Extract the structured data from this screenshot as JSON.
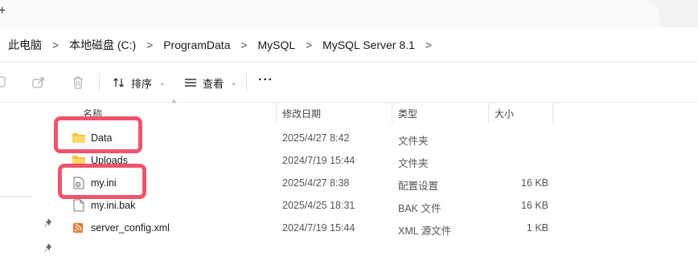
{
  "titlebar": {
    "new_tab_glyph": "+"
  },
  "breadcrumb": [
    {
      "label": "此电脑"
    },
    {
      "label": "本地磁盘 (C:)"
    },
    {
      "label": "ProgramData"
    },
    {
      "label": "MySQL"
    },
    {
      "label": "MySQL Server 8.1"
    }
  ],
  "breadcrumb_separator": ">",
  "toolbar": {
    "sort_label": "排序",
    "view_label": "查看",
    "more_label": "···",
    "dropdown_glyph": "⌄"
  },
  "columns": {
    "name": "名称",
    "date": "修改日期",
    "type": "类型",
    "size": "大小"
  },
  "files": [
    {
      "name": "Data",
      "date": "2025/4/27 8:42",
      "type": "文件夹",
      "size": "",
      "icon": "folder-icon"
    },
    {
      "name": "Uploads",
      "date": "2024/7/19 15:44",
      "type": "文件夹",
      "size": "",
      "icon": "folder-icon"
    },
    {
      "name": "my.ini",
      "date": "2025/4/27 8:38",
      "type": "配置设置",
      "size": "16 KB",
      "icon": "config-file-icon"
    },
    {
      "name": "my.ini.bak",
      "date": "2025/4/25 18:31",
      "type": "BAK 文件",
      "size": "16 KB",
      "icon": "file-icon"
    },
    {
      "name": "server_config.xml",
      "date": "2024/7/19 15:44",
      "type": "XML 源文件",
      "size": "1 KB",
      "icon": "xml-file-icon"
    }
  ],
  "colors": {
    "highlight": "#f0546a",
    "folder": "#f6c33d",
    "xml_icon": "#e8742a"
  }
}
